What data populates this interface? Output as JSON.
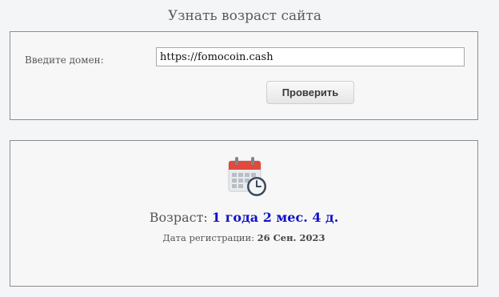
{
  "header": {
    "title": "Узнать возраст сайта"
  },
  "form": {
    "domain_label": "Введите домен:",
    "domain_value": "https://fomocoin.cash",
    "check_button": "Проверить"
  },
  "result": {
    "icon": "calendar-clock-icon",
    "age_label": "Возраст:",
    "age_value": "1 года 2 мес. 4 д.",
    "reg_label": "Дата регистрации:",
    "reg_value": "26 Сен. 2023"
  },
  "colors": {
    "age_value": "#1212c8",
    "calendar_header": "#e04a3c",
    "clock_face": "#3b4a5a"
  }
}
